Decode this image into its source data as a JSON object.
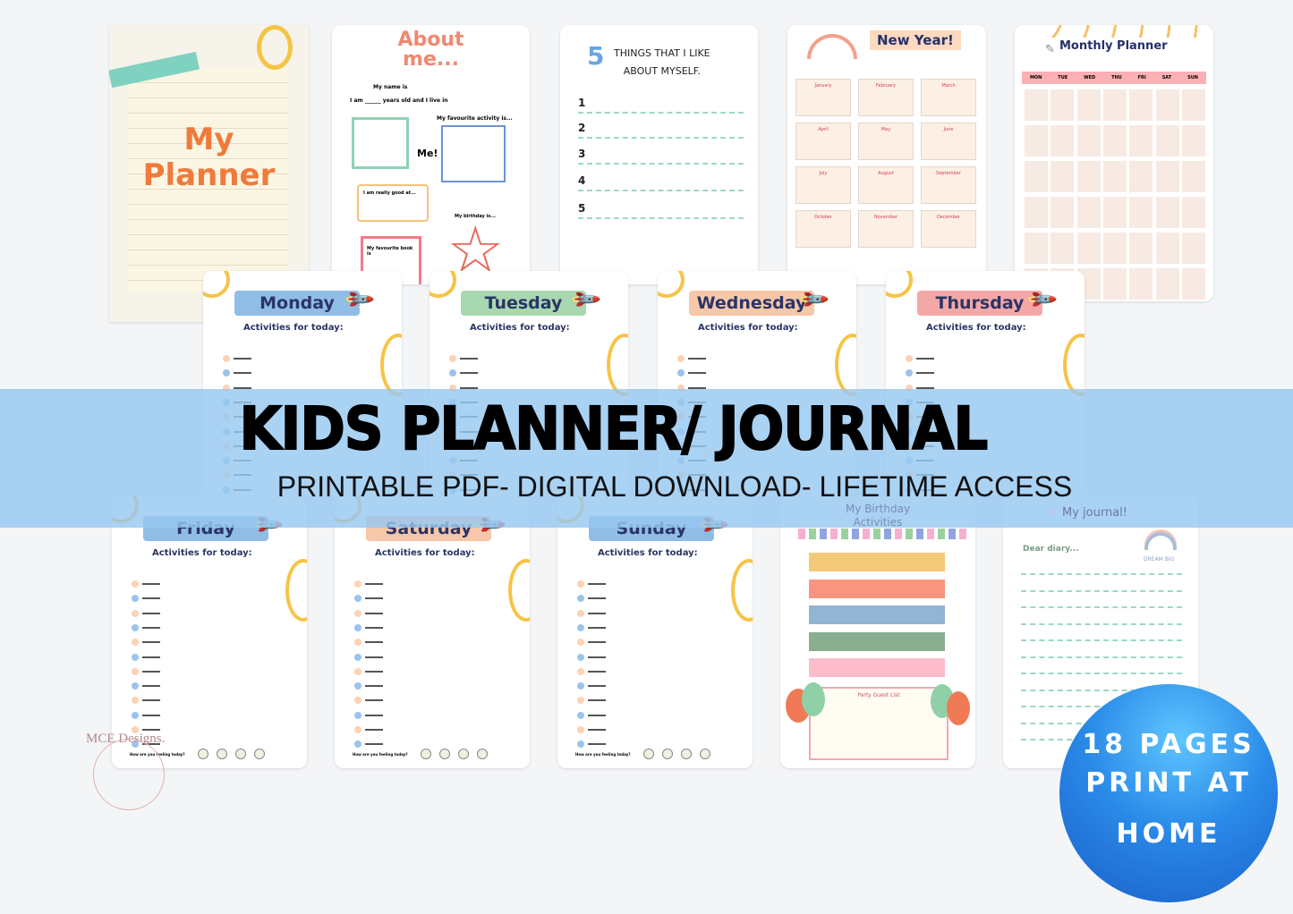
{
  "cover": {
    "title_line1": "My",
    "title_line2": "Planner"
  },
  "about": {
    "title_line1": "About",
    "title_line2": "me...",
    "name_label": "My name is",
    "age_label": "I am ______ years old and I live in",
    "me_label": "Me!",
    "activity_label": "My favourite activity is...",
    "good_at_label": "I am really good at...",
    "birthday_label": "My birthday is...",
    "book_label": "My favourite book is"
  },
  "things": {
    "number": "5",
    "title_line1": "THINGS THAT I LIKE",
    "title_line2": "ABOUT MYSELF.",
    "items": [
      "1",
      "2",
      "3",
      "4",
      "5"
    ]
  },
  "new_year": {
    "title": "New Year!",
    "months": [
      "January",
      "February",
      "March",
      "April",
      "May",
      "June",
      "July",
      "August",
      "September",
      "October",
      "November",
      "December"
    ]
  },
  "monthly": {
    "title": "Monthly Planner",
    "days": [
      "MON",
      "TUE",
      "WED",
      "THU",
      "FRI",
      "SAT",
      "SUN"
    ]
  },
  "weekdays": {
    "activities_label": "Activities for today:",
    "feeling_label": "How are you feeling today?",
    "days": [
      {
        "name": "Monday",
        "color": "#8fbde6"
      },
      {
        "name": "Tuesday",
        "color": "#a8d8b0"
      },
      {
        "name": "Wednesday",
        "color": "#f6c7a8"
      },
      {
        "name": "Thursday",
        "color": "#f4a7a7"
      },
      {
        "name": "Friday",
        "color": "#8fbde6"
      },
      {
        "name": "Saturday",
        "color": "#f6c7a8"
      },
      {
        "name": "Sunday",
        "color": "#8fbde6"
      }
    ]
  },
  "birthday": {
    "title_line1": "My Birthday",
    "title_line2": "Activities",
    "guest_list": "Party Guest List",
    "stripe_colors": [
      "#f5c97a",
      "#f79580",
      "#93b4d4",
      "#8aae90",
      "#fcbccb"
    ]
  },
  "journal": {
    "title": "My journal!",
    "dear": "Dear diary...",
    "dream": "DREAM BIG"
  },
  "banner": {
    "title": "KIDS PLANNER/ JOURNAL",
    "subtitle": "PRINTABLE PDF- DIGITAL DOWNLOAD- LIFETIME ACCESS"
  },
  "badge": {
    "line1": "18 PAGES",
    "line2": "PRINT AT",
    "line3": "HOME"
  },
  "watermark": {
    "text": "MCE Designs."
  }
}
